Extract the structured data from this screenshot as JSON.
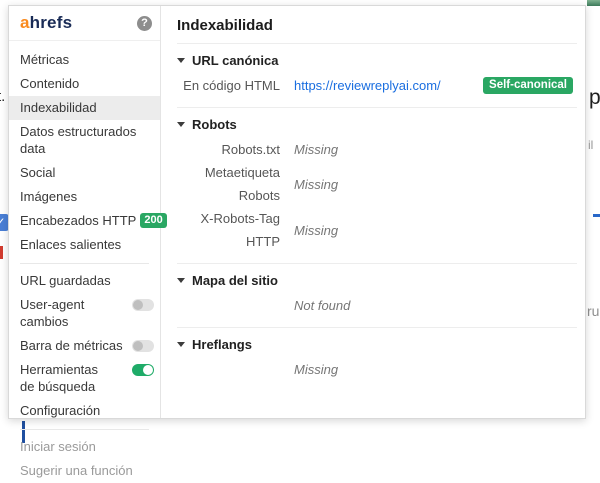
{
  "colors": {
    "logo_orange": "#f98a1e",
    "logo_navy": "#192b56",
    "link_blue": "#1a6ee0",
    "badge_green": "#2aa763",
    "toggle_on_green": "#1fab68",
    "selected_item_bg": "#ececec"
  },
  "header": {
    "logo_first_letter": "a",
    "logo_rest": "hrefs",
    "help_icon_glyph": "?"
  },
  "sidebar": {
    "items": [
      {
        "label": "Métricas"
      },
      {
        "label": "Contenido"
      },
      {
        "label": "Indexabilidad",
        "selected": true
      },
      {
        "label": "Datos estructurados data"
      },
      {
        "label": "Social"
      },
      {
        "label": "Imágenes"
      },
      {
        "label": "Encabezados HTTP",
        "badge": "200"
      },
      {
        "label": "Enlaces salientes"
      }
    ],
    "settings": [
      {
        "label": "URL guardadas"
      },
      {
        "label": "User-agent cambios",
        "toggle": "off"
      },
      {
        "label": "Barra de métricas",
        "toggle": "off"
      },
      {
        "label": "Herramientas de búsqueda",
        "toggle": "on"
      },
      {
        "label": "Configuración"
      }
    ],
    "footer_links": [
      {
        "label": "Iniciar sesión"
      },
      {
        "label": "Sugerir una función"
      }
    ]
  },
  "main": {
    "title": "Indexabilidad",
    "canonical": {
      "heading": "URL canónica",
      "label": "En código HTML",
      "url": "https://reviewreplyai.com/",
      "badge": "Self-canonical"
    },
    "robots": {
      "heading": "Robots",
      "rows": [
        {
          "label": "Robots.txt",
          "value": "Missing"
        },
        {
          "label": "Metaetiqueta Robots",
          "value": "Missing"
        },
        {
          "label": "X-Robots-Tag HTTP",
          "value": "Missing"
        }
      ]
    },
    "sitemap": {
      "heading": "Mapa del sitio",
      "value": "Not found"
    },
    "hreflangs": {
      "heading": "Hreflangs",
      "value": "Missing"
    }
  },
  "background_page": {
    "left_text_fragment": "t.",
    "checkmark_glyph": "✓",
    "right_text_fragment_p": "p",
    "right_text_fragment_il": "il",
    "right_text_fragment_ru": "ru"
  }
}
